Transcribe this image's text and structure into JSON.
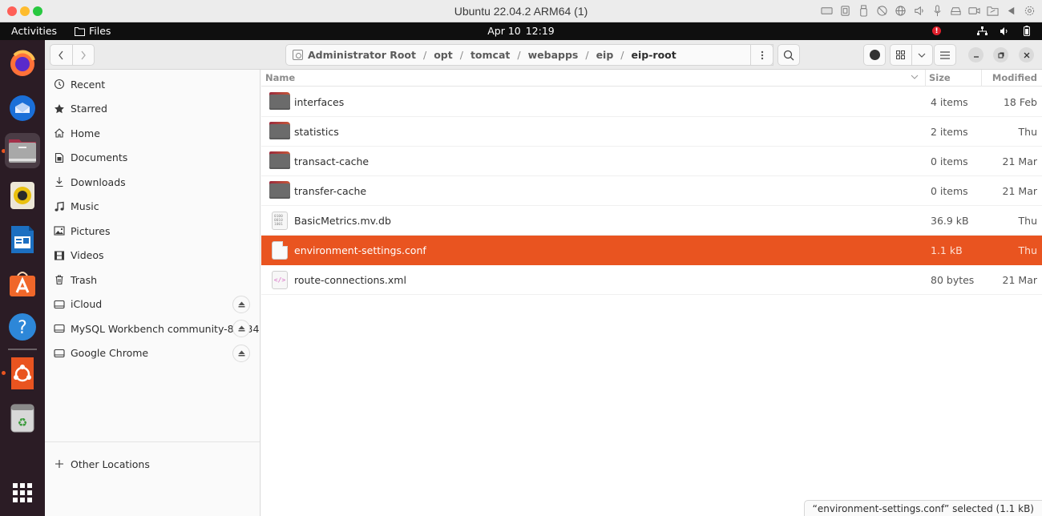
{
  "host": {
    "title": "Ubuntu 22.04.2 ARM64 (1)",
    "icons": [
      "keyboard-icon",
      "cpu-icon",
      "usb-icon",
      "no-network-icon",
      "globe-icon",
      "speaker-icon",
      "microphone-icon",
      "disk-icon",
      "camera-icon",
      "shared-folder-icon",
      "collapse-arrow-icon",
      "settings-gear-icon"
    ]
  },
  "topbar": {
    "activities": "Activities",
    "app_name": "Files",
    "date": "Apr 10",
    "time": "12:19",
    "alert_badge": "!"
  },
  "dock": {
    "apps": [
      "Firefox",
      "Thunderbird",
      "Files",
      "Rhythmbox",
      "LibreOffice Writer",
      "Ubuntu Software",
      "Help",
      "Ubuntu",
      "Trash"
    ]
  },
  "pathbar": {
    "crumbs": [
      "Administrator Root",
      "opt",
      "tomcat",
      "webapps",
      "eip",
      "eip-root"
    ],
    "separator": "/"
  },
  "sidebar": {
    "items": [
      {
        "label": "Recent",
        "icon": "clock-icon"
      },
      {
        "label": "Starred",
        "icon": "star-icon"
      },
      {
        "label": "Home",
        "icon": "home-icon"
      },
      {
        "label": "Documents",
        "icon": "document-icon"
      },
      {
        "label": "Downloads",
        "icon": "download-icon"
      },
      {
        "label": "Music",
        "icon": "music-icon"
      },
      {
        "label": "Pictures",
        "icon": "picture-icon"
      },
      {
        "label": "Videos",
        "icon": "video-icon"
      },
      {
        "label": "Trash",
        "icon": "trash-icon"
      }
    ],
    "devices": [
      {
        "label": "iCloud",
        "eject": "⏏"
      },
      {
        "label": "MySQL Workbench community-8.0.34",
        "eject": "⏏"
      },
      {
        "label": "Google Chrome",
        "eject": "⏏"
      }
    ],
    "other_locations": "Other Locations"
  },
  "list": {
    "columns": {
      "name": "Name",
      "size": "Size",
      "modified": "Modified"
    },
    "files": [
      {
        "name": "interfaces",
        "type": "folder",
        "size": "4 items",
        "modified": "18 Feb",
        "selected": false
      },
      {
        "name": "statistics",
        "type": "folder",
        "size": "2 items",
        "modified": "Thu",
        "selected": false
      },
      {
        "name": "transact-cache",
        "type": "folder",
        "size": "0 items",
        "modified": "21 Mar",
        "selected": false
      },
      {
        "name": "transfer-cache",
        "type": "folder",
        "size": "0 items",
        "modified": "21 Mar",
        "selected": false
      },
      {
        "name": "BasicMetrics.mv.db",
        "type": "binary",
        "size": "36.9 kB",
        "modified": "Thu",
        "selected": false
      },
      {
        "name": "environment-settings.conf",
        "type": "conf",
        "size": "1.1 kB",
        "modified": "Thu",
        "selected": true
      },
      {
        "name": "route-connections.xml",
        "type": "xml",
        "size": "80 bytes",
        "modified": "21 Mar",
        "selected": false
      }
    ]
  },
  "statusbar": {
    "text": "“environment-settings.conf” selected  (1.1 kB)"
  },
  "colors": {
    "accent": "#e95420",
    "dock_bg": "#2b1c25",
    "topbar_bg": "#0f0f0f"
  }
}
